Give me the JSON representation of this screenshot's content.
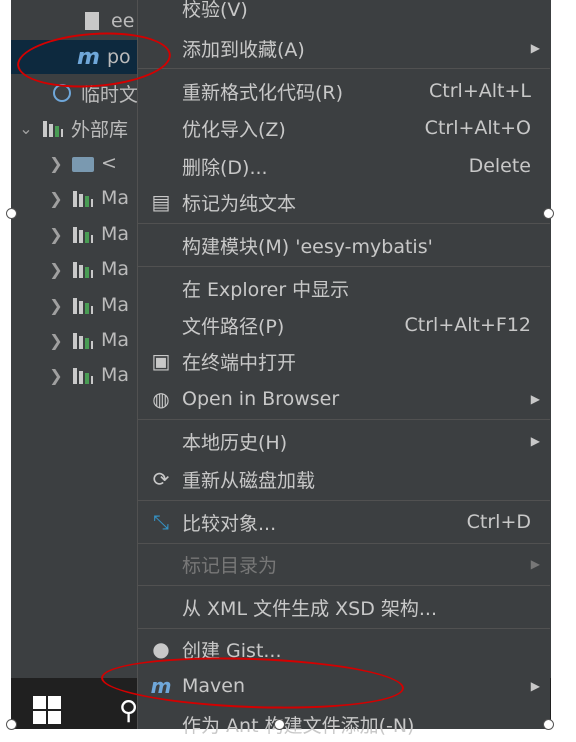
{
  "tree": {
    "rows": [
      {
        "type": "file",
        "label": "ee"
      },
      {
        "type": "maven",
        "label": "po"
      },
      {
        "type": "scratch",
        "label": "临时文"
      },
      {
        "type": "lib",
        "label": "外部库"
      },
      {
        "type": "folder",
        "label": "< "
      },
      {
        "type": "lib",
        "label": "Ma"
      },
      {
        "type": "lib",
        "label": "Ma"
      },
      {
        "type": "lib",
        "label": "Ma"
      },
      {
        "type": "lib",
        "label": "Ma"
      },
      {
        "type": "lib",
        "label": "Ma"
      },
      {
        "type": "lib",
        "label": "Ma"
      }
    ]
  },
  "menu": {
    "items": [
      {
        "label": "校验(V)",
        "mnemonic": "V"
      },
      {
        "label": "添加到收藏(A)",
        "submenu": true
      },
      {
        "label": "重新格式化代码(R)",
        "shortcut": "Ctrl+Alt+L"
      },
      {
        "label": "优化导入(Z)",
        "shortcut": "Ctrl+Alt+O"
      },
      {
        "label": "删除(D)...",
        "shortcut": "Delete"
      },
      {
        "label": "标记为纯文本",
        "icon": "plain-text-icon"
      },
      {
        "label": "构建模块(M) 'eesy-mybatis'"
      },
      {
        "label": "在 Explorer 中显示"
      },
      {
        "label": "文件路径(P)",
        "shortcut": "Ctrl+Alt+F12"
      },
      {
        "label": "在终端中打开",
        "icon": "terminal-icon"
      },
      {
        "label": "Open in Browser",
        "icon": "globe-icon",
        "submenu": true
      },
      {
        "label": "本地历史(H)",
        "submenu": true
      },
      {
        "label": "重新从磁盘加载",
        "icon": "reload-icon"
      },
      {
        "label": "比较对象...",
        "icon": "compare-icon",
        "shortcut": "Ctrl+D"
      },
      {
        "label": "标记目录为",
        "submenu": true,
        "disabled": true
      },
      {
        "label": "从 XML 文件生成 XSD 架构..."
      },
      {
        "label": "创建 Gist...",
        "icon": "github-icon"
      },
      {
        "label": "Maven",
        "icon": "maven-icon",
        "submenu": true
      },
      {
        "label": "作为 Ant 构建文件添加(-N)"
      }
    ]
  },
  "icons": {
    "submenu_arrow": "▶",
    "tree_expand": "❯",
    "tree_expanded": "⌄",
    "maven": "m"
  },
  "colors": {
    "panel_bg": "#3c3f41",
    "menu_text": "#c8c8c8",
    "disabled_text": "#777777",
    "annotation_red": "#d40000",
    "selection_bg": "#0d293e"
  }
}
